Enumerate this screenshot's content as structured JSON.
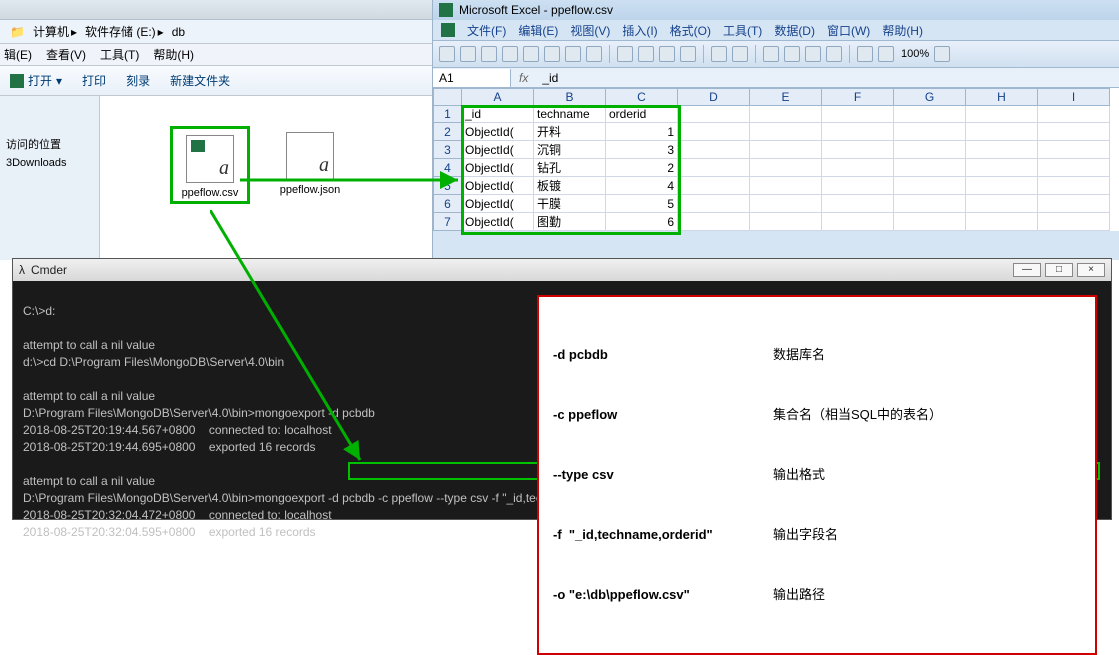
{
  "explorer": {
    "address": {
      "computer": "计算机",
      "drive": "软件存储 (E:)",
      "folder": "db"
    },
    "menu": {
      "edit": "辑(E)",
      "view": "查看(V)",
      "tools": "工具(T)",
      "help": "帮助(H)"
    },
    "toolbar": {
      "open": "打开",
      "print": "打印",
      "burn": "刻录",
      "newfolder": "新建文件夹"
    },
    "sidebar": {
      "recent": "访问的位置",
      "downloads": "3Downloads"
    },
    "files": [
      {
        "name": "ppeflow.csv",
        "kind": "csv"
      },
      {
        "name": "ppeflow.json",
        "kind": "json"
      }
    ]
  },
  "excel": {
    "title": "Microsoft Excel - ppeflow.csv",
    "menu": {
      "file": "文件(F)",
      "edit": "编辑(E)",
      "view": "视图(V)",
      "insert": "插入(I)",
      "format": "格式(O)",
      "tools": "工具(T)",
      "data": "数据(D)",
      "window": "窗口(W)",
      "help": "帮助(H)"
    },
    "zoom": "100%",
    "namebox": "A1",
    "formula": "_id",
    "columns": [
      "A",
      "B",
      "C",
      "D",
      "E",
      "F",
      "G",
      "H",
      "I"
    ],
    "rows": [
      {
        "r": "1",
        "a": "_id",
        "b": "techname",
        "c": "orderid"
      },
      {
        "r": "2",
        "a": "ObjectId(",
        "b": "开料",
        "c": "1"
      },
      {
        "r": "3",
        "a": "ObjectId(",
        "b": "沉铜",
        "c": "3"
      },
      {
        "r": "4",
        "a": "ObjectId(",
        "b": "钻孔",
        "c": "2"
      },
      {
        "r": "5",
        "a": "ObjectId(",
        "b": "板镀",
        "c": "4"
      },
      {
        "r": "6",
        "a": "ObjectId(",
        "b": "干膜",
        "c": "5"
      },
      {
        "r": "7",
        "a": "ObjectId(",
        "b": "图勤",
        "c": "6"
      }
    ]
  },
  "cmder": {
    "title": "Cmder",
    "lines": {
      "l1": "C:\\>d:",
      "l2": "",
      "l3": "attempt to call a nil value",
      "l4": "d:\\>cd D:\\Program Files\\MongoDB\\Server\\4.0\\bin",
      "l5": "",
      "l6": "attempt to call a nil value",
      "l7": "D:\\Program Files\\MongoDB\\Server\\4.0\\bin>mongoexport -d pcbdb",
      "l8": "2018-08-25T20:19:44.567+0800    connected to: localhost",
      "l9": "2018-08-25T20:19:44.695+0800    exported 16 records",
      "l10": "",
      "l11": "attempt to call a nil value",
      "l12_prompt": "D:\\Program Files\\MongoDB\\Server\\4.0\\bin>",
      "l12_cmd": "mongoexport -d pcbdb -c ppeflow --type csv -f \"_id,techname,orderid\" -o \"e:\\db\\ppeflow.csv\"",
      "l13": "2018-08-25T20:32:04.472+0800    connected to: localhost",
      "l14": "2018-08-25T20:32:04.595+0800    exported 16 records"
    },
    "annotations": [
      {
        "flag": "-d pcbdb",
        "desc": "数据库名"
      },
      {
        "flag": "-c ppeflow",
        "desc": "集合名（相当SQL中的表名）"
      },
      {
        "flag": "--type csv",
        "desc": "输出格式"
      },
      {
        "flag": "-f  \"_id,techname,orderid\"",
        "desc": "输出字段名"
      },
      {
        "flag": "-o \"e:\\db\\ppeflow.csv\"",
        "desc": "输出路径"
      }
    ]
  }
}
